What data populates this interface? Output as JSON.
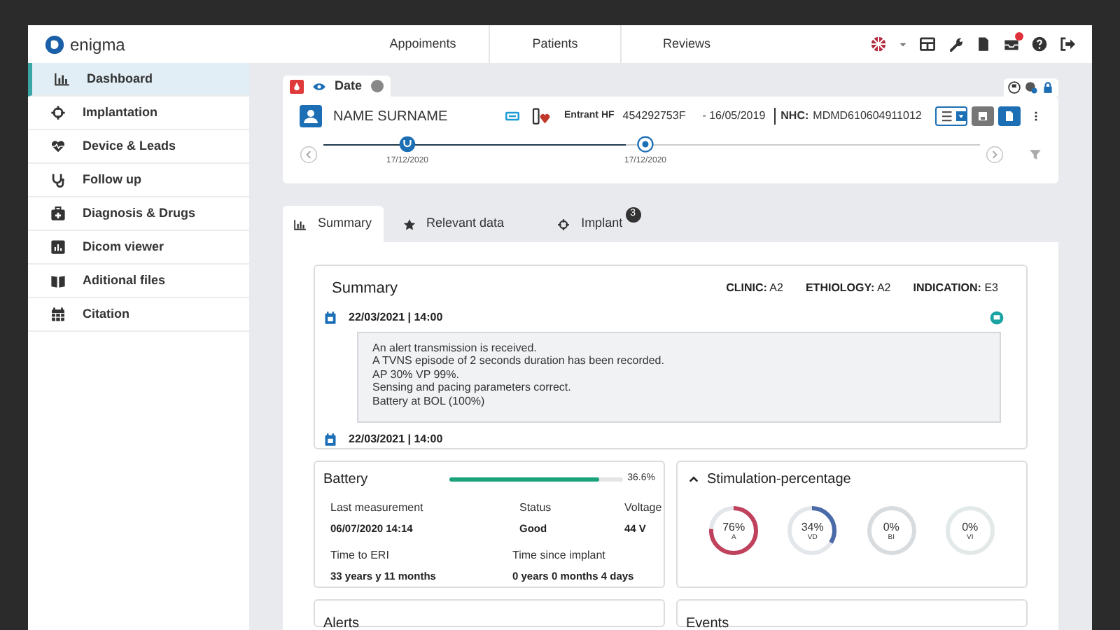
{
  "app": {
    "logo": "enigma"
  },
  "top_nav": [
    {
      "label": "Appoiments"
    },
    {
      "label": "Patients"
    },
    {
      "label": "Reviews"
    }
  ],
  "toolbar": {
    "notification_badge": true
  },
  "sidebar": {
    "items": [
      {
        "label": "Dashboard",
        "selected": true
      },
      {
        "label": "Implantation",
        "selected": false
      },
      {
        "label": "Device & Leads",
        "selected": false
      },
      {
        "label": "Follow up",
        "selected": false
      },
      {
        "label": "Diagnosis & Drugs",
        "selected": false
      },
      {
        "label": "Dicom viewer",
        "selected": false
      },
      {
        "label": "Aditional files",
        "selected": false
      },
      {
        "label": "Citation",
        "selected": false
      }
    ]
  },
  "patient": {
    "tab_label": "Date",
    "name": "NAME SURNAME",
    "device": "Entrant HF",
    "serial": "454292753F",
    "date": "- 16/05/2019",
    "nhc_label": "NHC:",
    "nhc": "MDMD610604911012",
    "timeline": [
      {
        "date": "17/12/2020"
      },
      {
        "date": "17/12/2020"
      }
    ]
  },
  "tabs": [
    {
      "label": "Summary",
      "selected": true
    },
    {
      "label": "Relevant data",
      "selected": false
    },
    {
      "label": "Implant",
      "selected": false,
      "badge": "3"
    }
  ],
  "summary": {
    "title": "Summary",
    "fields": [
      {
        "label": "CLINIC:",
        "value": "A2"
      },
      {
        "label": "ETHIOLOGY:",
        "value": "A2"
      },
      {
        "label": "INDICATION:",
        "value": "E3"
      }
    ],
    "entries": [
      {
        "datetime": "22/03/2021 | 14:00",
        "lines": [
          "An alert transmission is received.",
          "A TVNS episode of 2 seconds duration has been recorded.",
          "AP 30% VP 99%.",
          "Sensing and pacing parameters correct.",
          "Battery at BOL (100%)"
        ]
      },
      {
        "datetime": "22/03/2021 | 14:00"
      }
    ]
  },
  "battery": {
    "title": "Battery",
    "level": 0.86,
    "reading": "36.6%",
    "stats": [
      {
        "label": "Last measurement",
        "value": "06/07/2020 14:14"
      },
      {
        "label": "Status",
        "value": "Good"
      },
      {
        "label": "Voltage",
        "value": "44 V"
      }
    ],
    "stats_2": [
      {
        "label": "Time to ERI",
        "value": "33 years y 11 months"
      },
      {
        "label": "Time since implant",
        "value": "0 years 0 months 4 days"
      }
    ]
  },
  "stimulation": {
    "title": "Stimulation-percentage",
    "expanded": true,
    "gauges": [
      {
        "value": "76%",
        "label": "A",
        "level": 0.76,
        "color": "#c0415c"
      },
      {
        "value": "34%",
        "label": "VD",
        "level": 0.34,
        "color": "#4a6aa8"
      },
      {
        "value": "0%",
        "label": "BI"
      },
      {
        "value": "0%",
        "label": "VI"
      }
    ]
  },
  "bottom_cards": [
    {
      "title": "Alerts"
    },
    {
      "title": "Events"
    }
  ]
}
